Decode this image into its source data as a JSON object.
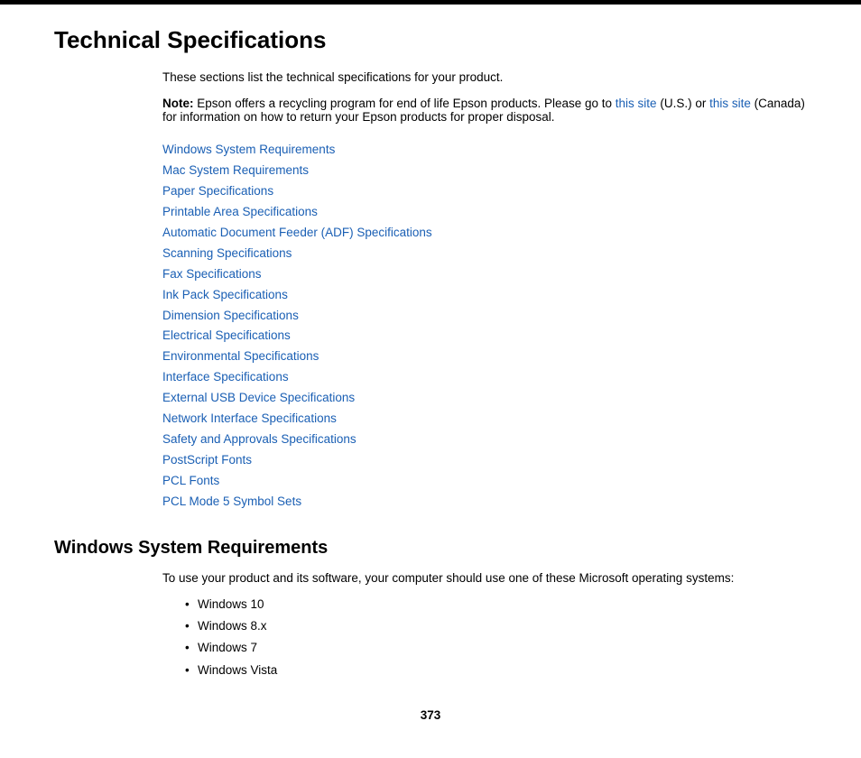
{
  "top_rule": true,
  "page_title": "Technical Specifications",
  "intro": {
    "text": "These sections list the technical specifications for your product."
  },
  "note": {
    "label": "Note:",
    "text_before_link1": " Epson offers a recycling program for end of life Epson products. Please go to ",
    "link1_text": "this site",
    "text_between_links": " (U.S.) or ",
    "link2_text": "this site",
    "text_after_link2": " (Canada) for information on how to return your Epson products for proper disposal."
  },
  "toc": {
    "items": [
      "Windows System Requirements",
      "Mac System Requirements",
      "Paper Specifications",
      "Printable Area Specifications",
      "Automatic Document Feeder (ADF) Specifications",
      "Scanning Specifications",
      "Fax Specifications",
      "Ink Pack Specifications",
      "Dimension Specifications",
      "Electrical Specifications",
      "Environmental Specifications",
      "Interface Specifications",
      "External USB Device Specifications",
      "Network Interface Specifications",
      "Safety and Approvals Specifications",
      "PostScript Fonts",
      "PCL Fonts",
      "PCL Mode 5 Symbol Sets"
    ]
  },
  "windows_section": {
    "title": "Windows System Requirements",
    "intro": "To use your product and its software, your computer should use one of these Microsoft operating systems:",
    "bullets": [
      "Windows 10",
      "Windows 8.x",
      "Windows 7",
      "Windows Vista"
    ]
  },
  "page_number": "373"
}
